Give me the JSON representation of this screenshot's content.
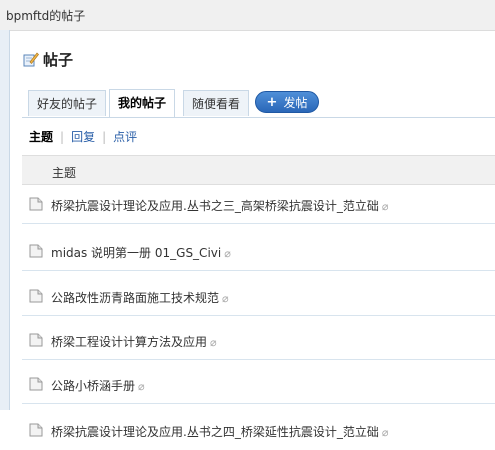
{
  "window": {
    "title": "bpmftd的帖子"
  },
  "page": {
    "title": "帖子",
    "title_icon": "pencil-notebook-icon"
  },
  "tabs": [
    {
      "label": "好友的帖子",
      "active": false
    },
    {
      "label": "我的帖子",
      "active": true
    },
    {
      "label": "随便看看",
      "active": false
    }
  ],
  "post_button": {
    "label": "发帖",
    "icon": "plus-icon"
  },
  "subnav": [
    {
      "label": "主题",
      "active": true
    },
    {
      "label": "回复",
      "active": false
    },
    {
      "label": "点评",
      "active": false
    }
  ],
  "table": {
    "header": "主题",
    "rows": [
      {
        "title": "桥梁抗震设计理论及应用.丛书之三_高架桥梁抗震设计_范立础"
      },
      {
        "title": "midas 说明第一册 01_GS_Civi"
      },
      {
        "title": "公路改性沥青路面施工技术规范"
      },
      {
        "title": "桥梁工程设计计算方法及应用"
      },
      {
        "title": "公路小桥涵手册"
      },
      {
        "title": "桥梁抗震设计理论及应用.丛书之四_桥梁延性抗震设计_范立础"
      }
    ]
  },
  "colors": {
    "link": "#2a5fa8",
    "button": "#2a67b8",
    "tab_bg": "#eef3f8"
  }
}
